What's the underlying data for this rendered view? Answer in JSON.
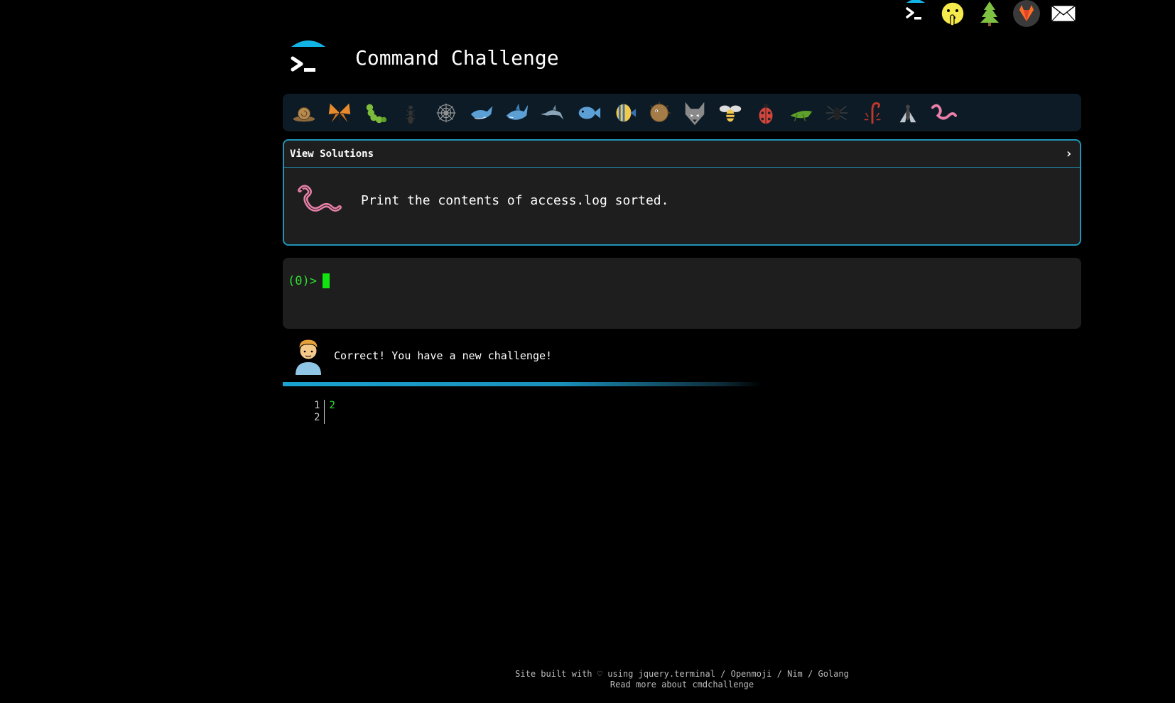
{
  "header": {
    "title": "Command Challenge"
  },
  "challenge": {
    "solutions_label": "View Solutions",
    "task": "Print the contents of access.log sorted."
  },
  "terminal": {
    "prompt": "(0)>"
  },
  "message": {
    "text": "Correct! You have a new challenge!"
  },
  "output": {
    "line_numbers": [
      "1",
      "2"
    ],
    "lines": [
      "2",
      ""
    ]
  },
  "footer": {
    "line1_prefix": "Site built with ♡ using ",
    "links": [
      "jquery.terminal",
      "Openmoji",
      "Nim",
      "Golang"
    ],
    "separator": " / ",
    "line2": "Read more about cmdchallenge"
  },
  "top_icons": [
    "terminal-icon",
    "shushing-face-icon",
    "tree-icon",
    "gitlab-icon",
    "envelope-icon"
  ],
  "levels": [
    "snail",
    "butterfly",
    "caterpillar",
    "ant",
    "spider-web",
    "whale",
    "shark",
    "dolphin",
    "fish",
    "tropical-fish",
    "blowfish",
    "wolf",
    "bee",
    "ladybug",
    "cricket",
    "spider",
    "scorpion",
    "fly",
    "worm"
  ],
  "colors": {
    "accent": "#1f93b8",
    "prompt_green": "#2fe02f",
    "panel_bg": "#1e1e1e",
    "level_bar_bg": "#0d1b26"
  }
}
